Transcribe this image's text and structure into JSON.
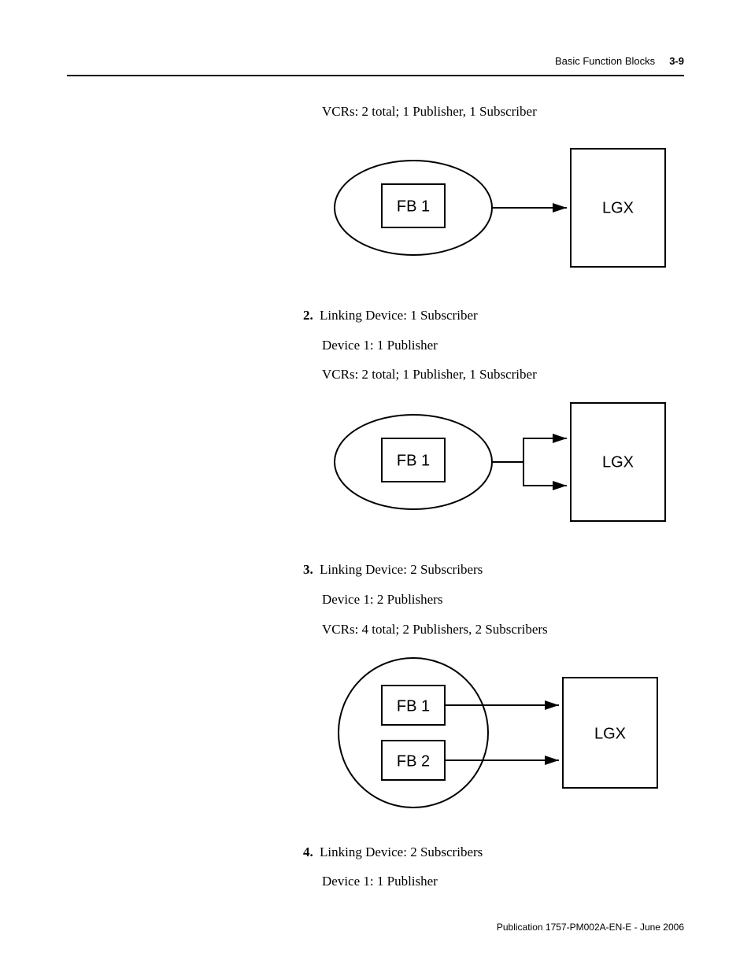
{
  "header": {
    "section": "Basic Function Blocks",
    "page": "3-9"
  },
  "intro_vcrs": "VCRs: 2 total; 1 Publisher, 1 Subscriber",
  "item2": {
    "num": "2.",
    "line1": "Linking Device: 1 Subscriber",
    "line2": "Device 1: 1 Publisher",
    "line3": "VCRs: 2 total; 1 Publisher, 1 Subscriber"
  },
  "item3": {
    "num": "3.",
    "line1": "Linking Device: 2 Subscribers",
    "line2": "Device 1: 2 Publishers",
    "line3": "VCRs: 4 total; 2 Publishers, 2 Subscribers"
  },
  "item4": {
    "num": "4.",
    "line1": "Linking Device: 2 Subscribers",
    "line2": "Device 1: 1 Publisher"
  },
  "labels": {
    "fb1": "FB 1",
    "fb2": "FB 2",
    "lgx": "LGX"
  },
  "footer": "Publication 1757-PM002A-EN-E - June 2006"
}
